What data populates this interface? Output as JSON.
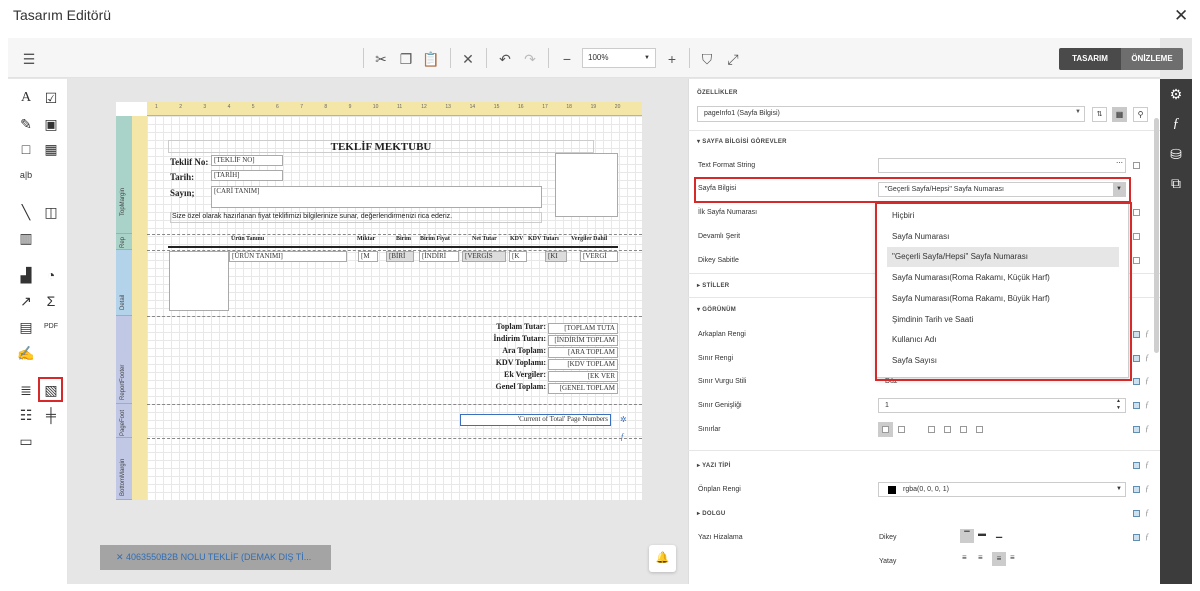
{
  "window": {
    "title": "Tasarım Editörü",
    "close": "✕"
  },
  "toolbar": {
    "zoom": "100%",
    "mode_design": "TASARIM",
    "mode_preview": "ÖNİZLEME",
    "colors": {
      "design_bg": "#4a4a4a",
      "preview_bg": "#6e6e6e"
    }
  },
  "report": {
    "title": "TEKLİF MEKTUBU",
    "labels": {
      "teklif_no": "Teklif No:",
      "tarih": "Tarih:",
      "sayin": "Sayın;"
    },
    "fields": {
      "teklif_no": "[TEKLİF NO]",
      "tarih": "[TARİH]",
      "cari": "[CARİ TANIM]"
    },
    "intro": "Size özel olarak hazırlanan fiyat teklifimizi bilgilerinize sunar, değerlendirmenizi rica ederiz.",
    "columns": [
      "Ürün Tanımı",
      "Miktar",
      "Birim",
      "Birim Fiyat",
      "Net Tutar",
      "KDV",
      "KDV Tutarı",
      "Vergiler Dahil"
    ],
    "detail": [
      "[ÜRÜN TANIMI]",
      "[M",
      "[BİRİ",
      "[İNDİRİ",
      "[VERGİS",
      "[K",
      "[KI",
      "[VERGİ"
    ],
    "totals": [
      {
        "label": "Toplam Tutar:",
        "field": "[TOPLAM TUTA"
      },
      {
        "label": "İndirim Tutarı:",
        "field": "[İNDİRİM TOPLAM"
      },
      {
        "label": "Ara Toplam:",
        "field": "[ARA TOPLAM"
      },
      {
        "label": "KDV Toplamı:",
        "field": "[KDV TOPLAM"
      },
      {
        "label": "Ek Vergiler:",
        "field": "[EK VER"
      },
      {
        "label": "Genel Toplam:",
        "field": "[GENEL TOPLAM"
      }
    ],
    "page_info": "'Current of Total' Page Numbers",
    "bands": [
      "TopMargin",
      "Rep",
      "Detail",
      "ReportFooter",
      "PageFoot",
      "BottomMargin"
    ],
    "ruler": [
      "1",
      "2",
      "3",
      "4",
      "5",
      "6",
      "7",
      "8",
      "9",
      "10",
      "11",
      "12",
      "13",
      "14",
      "15",
      "16",
      "17",
      "18",
      "19",
      "20"
    ]
  },
  "properties": {
    "header": "ÖZELLİKLER",
    "selected": "pageInfo1 (Sayfa Bilgisi)",
    "sections": {
      "tasks": "SAYFA BİLGİSİ GÖREVLER",
      "styles": "STİLLER",
      "appearance": "GÖRÜNÜM",
      "font": "YAZI TİPİ",
      "padding": "DOLGU"
    },
    "rows": {
      "text_format": "Text Format String",
      "page_info": "Sayfa Bilgisi",
      "page_info_value": "\"Geçerli Sayfa/Hepsi\" Sayfa Numarası",
      "first_page": "İlk Sayfa Numarası",
      "continuous": "Devamlı Şerit",
      "vertical": "Dikey Sabitle",
      "bg_color": "Arkaplan Rengi",
      "border_color": "Sınır Rengi",
      "border_dash": "Sınır Vurgu Stili",
      "border_dash_value": "Düz",
      "border_width": "Sınır Genişliği",
      "border_width_value": "1",
      "borders": "Sınırlar",
      "fore_color": "Önplan Rengi",
      "fore_color_value": "rgba(0, 0, 0, 1)",
      "text_align": "Yazı Hizalama",
      "vertical_align": "Dikey",
      "horizontal_align": "Yatay"
    },
    "dropdown": [
      "Hiçbiri",
      "Sayfa Numarası",
      "\"Geçerli Sayfa/Hepsi\" Sayfa Numarası",
      "Sayfa Numarası(Roma Rakamı, Küçük Harf)",
      "Sayfa Numarası(Roma Rakamı, Büyük Harf)",
      "Şimdinin Tarih ve Saati",
      "Kullanıcı Adı",
      "Sayfa Sayısı"
    ]
  },
  "toast": "✕ 4063550B2B NOLU TEKLİF (DEMAK DIŞ Tİ..."
}
